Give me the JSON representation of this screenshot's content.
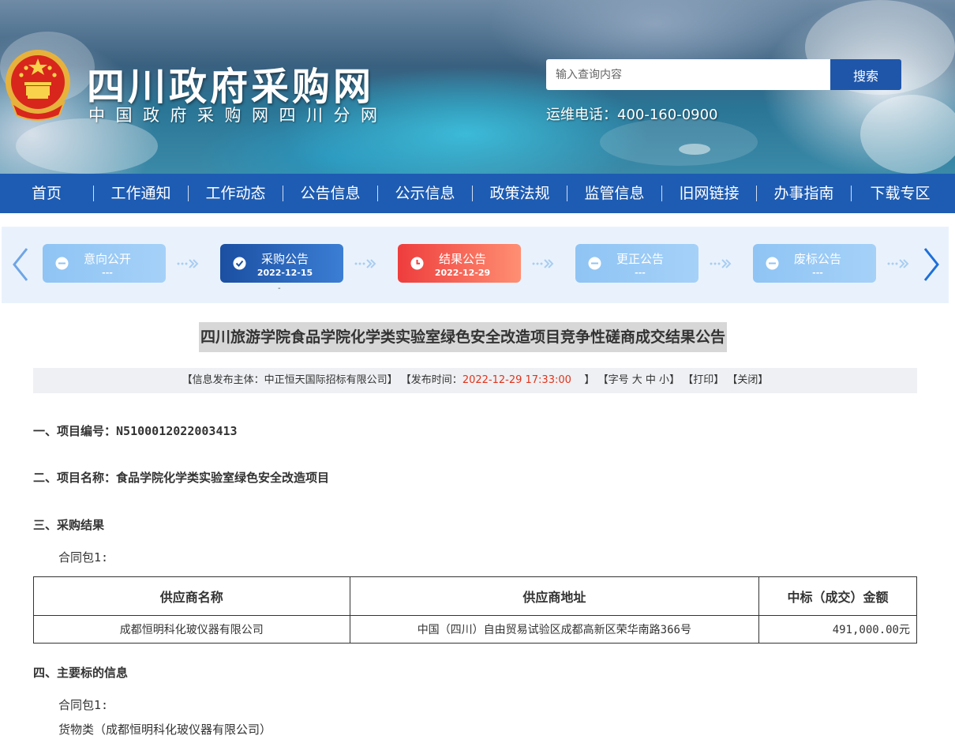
{
  "header": {
    "site_title": "四川政府采购网",
    "site_subtitle": "中国政府采购网四川分网",
    "search_placeholder": "输入查询内容",
    "search_button": "搜索",
    "hotline": "运维电话：400-160-0900"
  },
  "nav": {
    "items": [
      "首页",
      "工作通知",
      "工作动态",
      "公告信息",
      "公示信息",
      "政策法规",
      "监管信息",
      "旧网链接",
      "办事指南",
      "下载专区"
    ]
  },
  "steps": [
    {
      "label": "意向公开",
      "date": "---",
      "state": "pending"
    },
    {
      "label": "采购公告",
      "date": "2022-12-15",
      "state": "done"
    },
    {
      "label": "结果公告",
      "date": "2022-12-29",
      "state": "current"
    },
    {
      "label": "更正公告",
      "date": "---",
      "state": "pending"
    },
    {
      "label": "废标公告",
      "date": "---",
      "state": "pending"
    }
  ],
  "steps_extra": {
    "dash": "-"
  },
  "article": {
    "title": "四川旅游学院食品学院化学类实验室绿色安全改造项目竞争性磋商成交结果公告",
    "meta": {
      "publisher_prefix": "【信息发布主体：",
      "publisher": "中正恒天国际招标有限公司",
      "publisher_suffix": "】",
      "time_prefix": "【发布时间：",
      "time": "2022-12-29 17:33:00",
      "time_suffix": "】",
      "font_size_prefix": "【字号",
      "font_large": "大",
      "font_medium": "中",
      "font_small": "小",
      "font_size_suffix": "】",
      "print": "【打印】",
      "close": "【关闭】"
    },
    "sec1_label": "一、项目编号：",
    "sec1_value": "N5100012022003413",
    "sec2_label": "二、项目名称：",
    "sec2_value": "食品学院化学类实验室绿色安全改造项目",
    "sec3_label": "三、采购结果",
    "package_label": "合同包1:",
    "table": {
      "headers": [
        "供应商名称",
        "供应商地址",
        "中标（成交）金额"
      ],
      "rows": [
        [
          "成都恒明科化玻仪器有限公司",
          "中国（四川）自由贸易试验区成都高新区荣华南路366号",
          "491,000.00元"
        ]
      ]
    },
    "sec4_label": "四、主要标的信息",
    "package_label_2": "合同包1:",
    "goods_line": "货物类（成都恒明科化玻仪器有限公司）"
  },
  "colors": {
    "nav_bg": "#1e5cb3",
    "search_button": "#1f56a9",
    "step_done": "#1b4fa2",
    "step_current": "#ee3d3d",
    "step_pending": "#8fc4f4",
    "meta_time": "#e0341c"
  },
  "icons": {
    "emblem": "national-emblem",
    "step_pending": "minus-circle-icon",
    "step_done": "check-circle-icon",
    "step_current": "clock-icon",
    "arrow_left": "chevron-left-icon",
    "arrow_right": "chevron-right-icon"
  }
}
